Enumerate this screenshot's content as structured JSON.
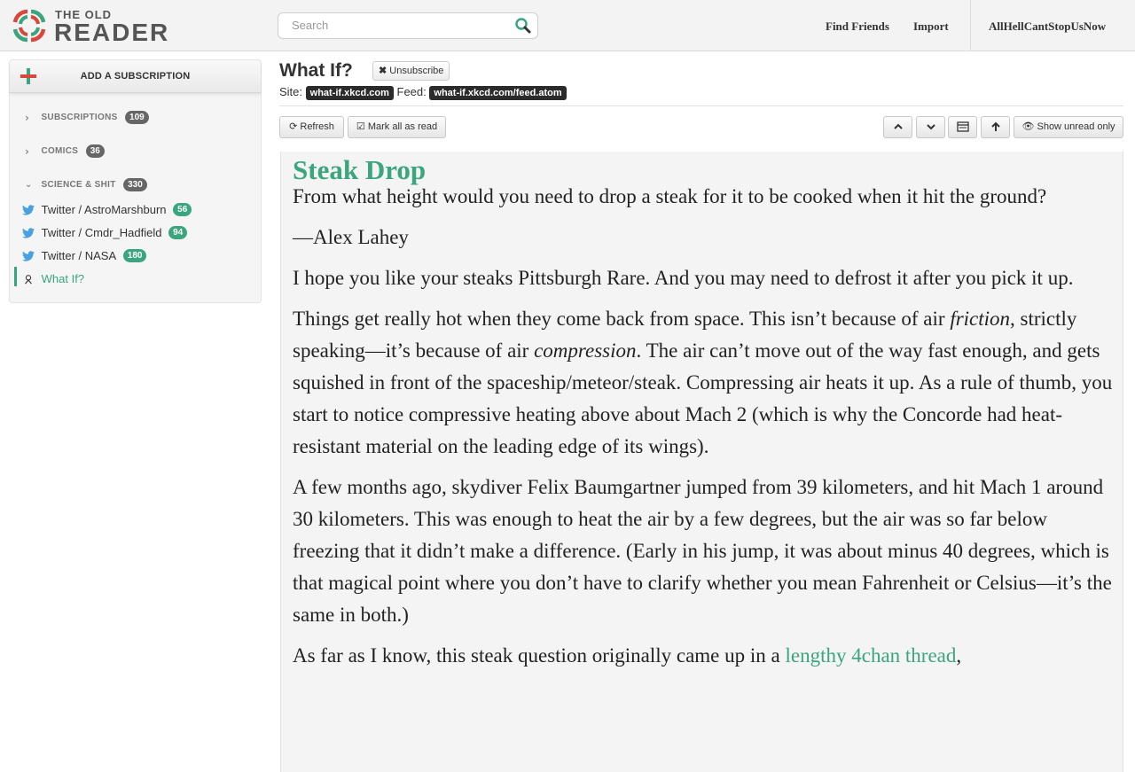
{
  "app": {
    "logo_small": "THE OLD",
    "logo_big": "READER"
  },
  "search": {
    "placeholder": "Search"
  },
  "topnav": {
    "find_friends": "Find Friends",
    "import": "Import",
    "username": "AllHellCantStopUsNow"
  },
  "sidebar": {
    "add_subscription": "ADD A SUBSCRIPTION",
    "folders": [
      {
        "name": "SUBSCRIPTIONS",
        "count": "109",
        "state": "collapsed"
      },
      {
        "name": "COMICS",
        "count": "36",
        "state": "collapsed"
      },
      {
        "name": "SCIENCE & SHIT",
        "count": "330",
        "state": "expanded"
      }
    ],
    "feeds": [
      {
        "label": "Twitter / AstroMarshburn",
        "count": "56",
        "icon": "twitter-icon"
      },
      {
        "label": "Twitter / Cmdr_Hadfield",
        "count": "94",
        "icon": "twitter-icon"
      },
      {
        "label": "Twitter / NASA",
        "count": "180",
        "icon": "twitter-icon"
      },
      {
        "label": "What If?",
        "count": "",
        "icon": "xkcd-icon"
      }
    ]
  },
  "feed": {
    "title": "What If?",
    "unsubscribe": "Unsubscribe",
    "site_label": "Site:",
    "site_url": "what-if.xkcd.com",
    "feed_label": "Feed:",
    "feed_url": "what-if.xkcd.com/feed.atom"
  },
  "toolbar": {
    "refresh": "Refresh",
    "mark_all_read": "Mark all as read",
    "show_unread": "Show unread only"
  },
  "article": {
    "title": "Steak Drop",
    "p1": "From what height would you need to drop a steak for it to be cooked when it hit the ground?",
    "p2": "—Alex Lahey",
    "p3": "I hope you like your steaks Pittsburgh Rare. And you may need to defrost it after you pick it up.",
    "p4a": "Things get really hot when they come back from space. This isn’t because of air ",
    "p4b": "friction",
    "p4c": ", strictly speaking—it’s because of air ",
    "p4d": "compression",
    "p4e": ". The air can’t move out of the way fast enough, and gets squished in front of the spaceship/meteor/steak. Compressing air heats it up. As a rule of thumb, you start to notice compressive heating above about Mach 2 (which is why the Concorde had heat-resistant material on the leading edge of its wings).",
    "p5": "A few months ago, skydiver Felix Baumgartner jumped from 39 kilometers, and hit Mach 1 around 30 kilometers. This was enough to heat the air by a few degrees, but the air was so far below freezing that it didn’t make a difference. (Early in his jump, it was about minus 40 degrees, which is that magical point where you don’t have to clarify whether you mean Fahrenheit or Celsius—it’s the same in both.)",
    "p6a": "As far as I know, this steak question originally came up in a ",
    "p6_link": "lengthy 4chan thread",
    "p6b": ","
  },
  "colors": {
    "accent": "#3aa57e",
    "badge_gray": "#666666",
    "pill_dark": "#2b2b2b"
  }
}
